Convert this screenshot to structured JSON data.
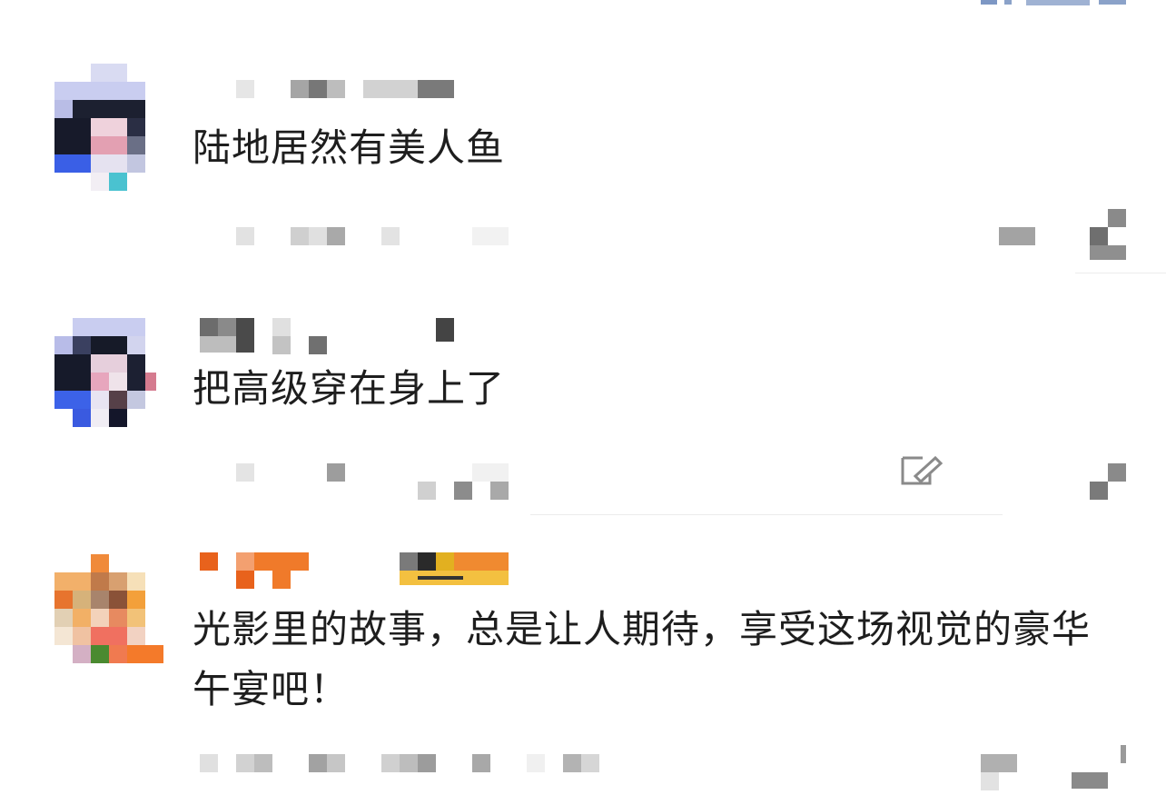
{
  "comments": [
    {
      "text": "陆地居然有美人鱼"
    },
    {
      "text": "把高级穿在身上了"
    },
    {
      "text": "光影里的故事，总是让人期待，享受这场视觉的豪华午宴吧！"
    }
  ],
  "icons": {
    "edit": "edit-icon",
    "like": "like-icon"
  },
  "colors": {
    "divider": "#ececec",
    "link": "#5b7fb8",
    "text": "#1e1e1e"
  }
}
